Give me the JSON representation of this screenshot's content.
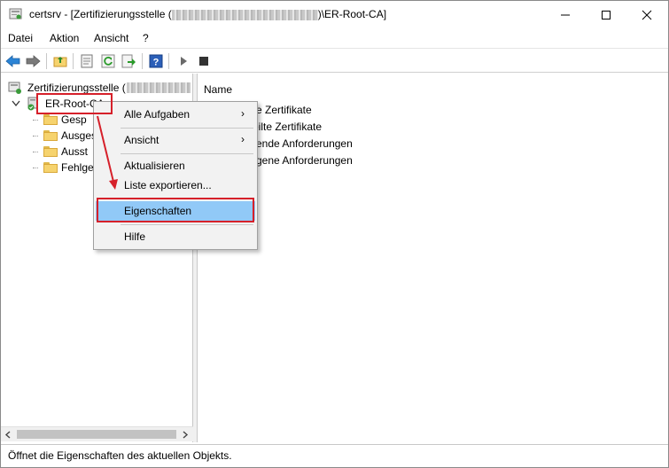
{
  "window": {
    "title_prefix": "certsrv - [Zertifizierungsstelle (",
    "title_suffix": ")\\ER-Root-CA]"
  },
  "menubar": {
    "items": [
      "Datei",
      "Aktion",
      "Ansicht",
      "?"
    ]
  },
  "tree": {
    "root_label": "Zertifizierungsstelle (",
    "ca_label": "ER-Root-CA",
    "children": [
      "Gesperrte Zertifikate",
      "Ausgestellte Zertifikate",
      "Ausstehende Anforderungen",
      "Fehlgeschlagene Anforderungen"
    ],
    "visible_children": [
      "Gesp",
      "Ausges",
      "Ausst",
      "Fehlge"
    ]
  },
  "list": {
    "column_name": "Name",
    "items": [
      "Gesperrte Zertifikate",
      "Ausgestellte Zertifikate",
      "Ausstehende Anforderungen",
      "Fehlgeschlagene Anforderungen"
    ],
    "visible_items": [
      "e Zertifikate",
      "eilte Zertifikate",
      "ende Anforderungen",
      "gene Anforderungen"
    ]
  },
  "context_menu": {
    "items": [
      {
        "label": "Alle Aufgaben",
        "submenu": true
      },
      {
        "label": "Ansicht",
        "submenu": true
      },
      {
        "label": "Aktualisieren",
        "submenu": false
      },
      {
        "label": "Liste exportieren...",
        "submenu": false
      },
      {
        "label": "Eigenschaften",
        "submenu": false,
        "selected": true
      },
      {
        "label": "Hilfe",
        "submenu": false
      }
    ],
    "submenu_arrow": "›"
  },
  "statusbar": {
    "text": "Öffnet die Eigenschaften des aktuellen Objekts."
  },
  "colors": {
    "highlight": "#91c9f7",
    "annotation": "#d6202a",
    "folder": "#f6d36e"
  },
  "icons": [
    "back-icon",
    "forward-icon",
    "up-folder-icon",
    "properties-icon",
    "refresh-icon",
    "export-icon",
    "help-icon",
    "play-icon",
    "stop-icon"
  ]
}
